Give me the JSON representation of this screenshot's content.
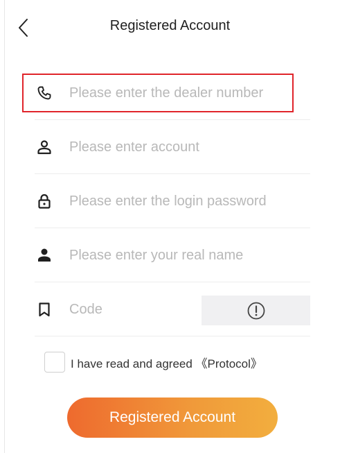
{
  "header": {
    "title": "Registered Account",
    "back_icon": "chevron-left-icon"
  },
  "form": {
    "dealer_number": {
      "placeholder": "Please enter the dealer number",
      "value": "",
      "icon": "phone-icon"
    },
    "account": {
      "placeholder": "Please enter account",
      "value": "",
      "icon": "user-outline-icon"
    },
    "password": {
      "placeholder": "Please enter the login password",
      "value": "",
      "icon": "lock-icon"
    },
    "real_name": {
      "placeholder": "Please enter your real name",
      "value": "",
      "icon": "user-filled-icon"
    },
    "code": {
      "placeholder": "Code",
      "value": "",
      "icon": "bookmark-icon",
      "button_icon": "exclamation-circle-icon"
    }
  },
  "agreement": {
    "checked": false,
    "text": "I have read and agreed 《Protocol》"
  },
  "submit": {
    "label": "Registered Account"
  },
  "colors": {
    "highlight": "#e0242a",
    "button_start": "#ee6a2e",
    "button_end": "#f2ae3e",
    "placeholder": "#b8b8b8"
  }
}
